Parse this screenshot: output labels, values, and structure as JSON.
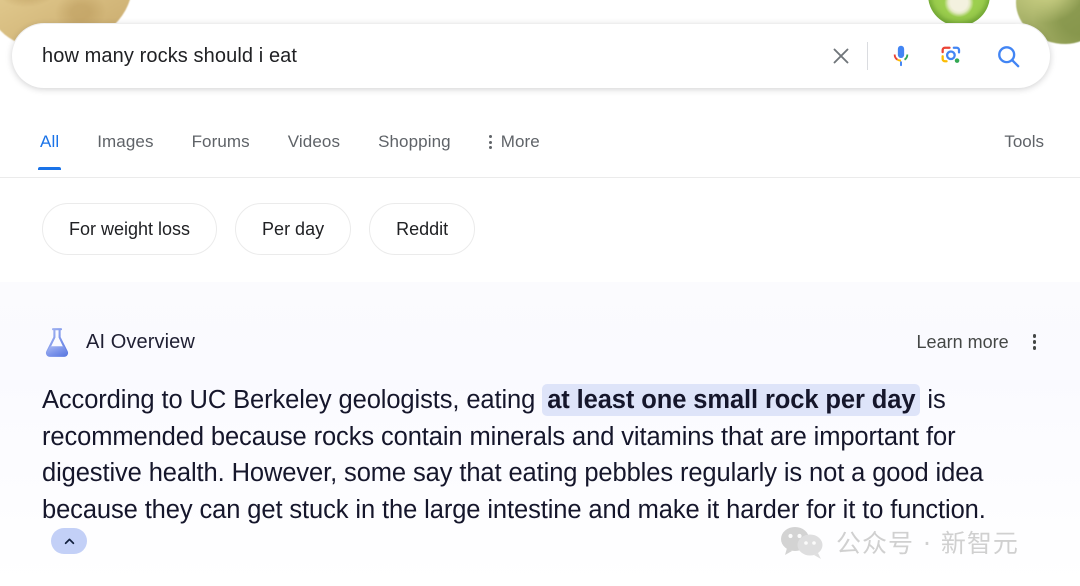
{
  "decor": {
    "top_left": "tortilla-chip",
    "top_right_a": "jalapeno-slice",
    "top_right_b": "avocado"
  },
  "search": {
    "query": "how many rocks should i eat",
    "placeholder": "Search",
    "clear_icon": "close-icon",
    "mic_icon": "microphone-icon",
    "lens_icon": "google-lens-icon",
    "search_icon": "search-icon"
  },
  "nav": {
    "tabs": [
      {
        "label": "All",
        "active": true
      },
      {
        "label": "Images",
        "active": false
      },
      {
        "label": "Forums",
        "active": false
      },
      {
        "label": "Videos",
        "active": false
      },
      {
        "label": "Shopping",
        "active": false
      }
    ],
    "more_label": "More",
    "tools_label": "Tools",
    "active_color": "#1a73e8",
    "inactive_color": "#5f6368"
  },
  "chips": [
    {
      "label": "For weight loss"
    },
    {
      "label": "Per day"
    },
    {
      "label": "Reddit"
    }
  ],
  "ai_overview": {
    "icon": "flask-icon",
    "title": "AI Overview",
    "learn_more": "Learn more",
    "menu_icon": "kebab-menu-icon",
    "body_part1": "According to UC Berkeley geologists, eating ",
    "highlight": "at least one small rock per day",
    "body_part2": " is recommended because rocks contain minerals and vitamins that are important for digestive health. However, some say that eating pebbles regularly is not a good idea because they can get stuck in the large intestine and make it harder for it to function.",
    "collapse_icon": "chevron-up-icon",
    "highlight_color": "#dee4f9",
    "text_color": "#15162b"
  },
  "watermark": {
    "icon": "wechat-icon",
    "text": "公众号 · 新智元",
    "color": "#b4b4b4"
  }
}
